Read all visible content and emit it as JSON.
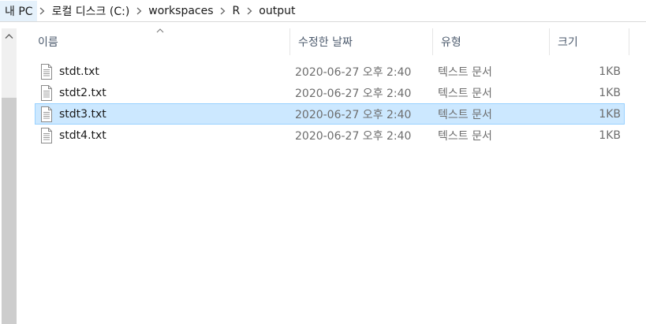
{
  "breadcrumb": {
    "items": [
      "내 PC",
      "로컬 디스크 (C:)",
      "workspaces",
      "R",
      "output"
    ]
  },
  "columns": {
    "name": "이름",
    "date": "수정한 날짜",
    "type": "유형",
    "size": "크기"
  },
  "files": [
    {
      "name": "stdt.txt",
      "date": "2020-06-27 오후 2:40",
      "type": "텍스트 문서",
      "size": "1KB",
      "selected": false
    },
    {
      "name": "stdt2.txt",
      "date": "2020-06-27 오후 2:40",
      "type": "텍스트 문서",
      "size": "1KB",
      "selected": false
    },
    {
      "name": "stdt3.txt",
      "date": "2020-06-27 오후 2:40",
      "type": "텍스트 문서",
      "size": "1KB",
      "selected": true
    },
    {
      "name": "stdt4.txt",
      "date": "2020-06-27 오후 2:40",
      "type": "텍스트 문서",
      "size": "1KB",
      "selected": false
    }
  ],
  "colors": {
    "selection_bg": "#cce8ff",
    "selection_border": "#99d1ff",
    "breadcrumb_hover": "#e5f1fb"
  },
  "icons": {
    "file": "text-file-icon",
    "separator": "chevron-right-icon",
    "scroll_up": "chevron-up-icon",
    "sort": "sort-ascending-icon"
  }
}
